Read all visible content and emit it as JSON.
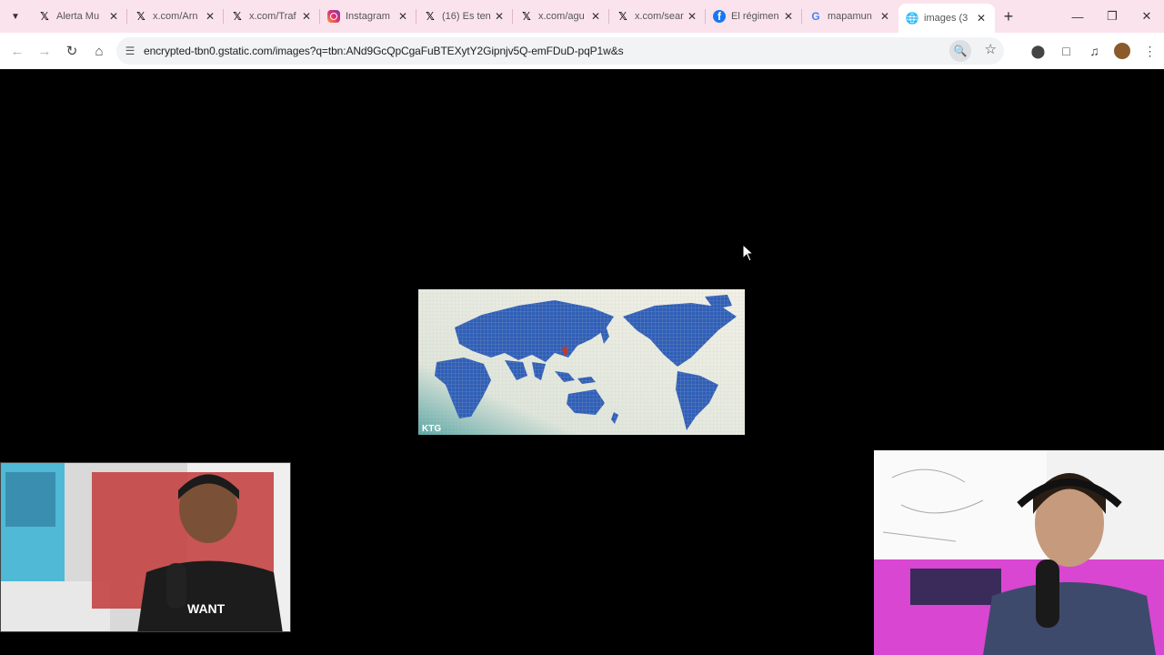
{
  "browser": {
    "tabs": [
      {
        "title": "Alerta Mu",
        "icon": "x-logo-icon",
        "active": false
      },
      {
        "title": "x.com/Arn",
        "icon": "x-logo-icon",
        "active": false
      },
      {
        "title": "x.com/Traf",
        "icon": "x-logo-icon",
        "active": false
      },
      {
        "title": "Instagram",
        "icon": "instagram-icon",
        "active": false
      },
      {
        "title": "(16) Es ten",
        "icon": "x-logo-icon",
        "active": false
      },
      {
        "title": "x.com/agu",
        "icon": "x-logo-icon",
        "active": false
      },
      {
        "title": "x.com/sear",
        "icon": "x-logo-icon",
        "active": false
      },
      {
        "title": "El régimen",
        "icon": "facebook-icon",
        "active": false
      },
      {
        "title": "mapamun",
        "icon": "google-icon",
        "active": false
      },
      {
        "title": "images (3",
        "icon": "globe-icon",
        "active": true
      }
    ],
    "address": {
      "url": "encrypted-tbn0.gstatic.com/images?q=tbn:ANd9GcQpCgaFuBTEXytY2Gipnjv5Q-emFDuD-pqP1w&s"
    }
  },
  "content": {
    "image": {
      "watermark": "KTG",
      "description_icon": "world-map-image"
    }
  },
  "colors": {
    "tabstrip_bg": "#fbe3ee",
    "page_bg": "#000000",
    "map_land": "#2f5fb8",
    "map_sea": "#eeece2"
  }
}
